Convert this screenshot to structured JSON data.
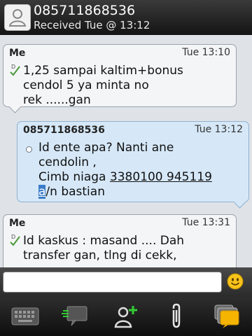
{
  "header": {
    "title": "085711868536",
    "subtitle": "Received Tue @ 13:12",
    "avatar_icon": "contact-avatar-icon"
  },
  "messages": [
    {
      "sender": "Me",
      "time": "Tue 13:10",
      "status_icon": "delivered-check-icon",
      "lines": [
        "1,25 sampai kaltim+bonus",
        "cendol 5 ya minta no",
        "rek ......gan"
      ]
    },
    {
      "sender": "085711868536",
      "time": "Tue 13:12",
      "lines": [
        "Id ente apa? Nanti ane",
        "cendolin ,"
      ],
      "line3_prefix": "Cimb niaga ",
      "line3_number": "3380100 945119",
      "line4_selected": "a",
      "line4_rest": "/n bastian"
    },
    {
      "sender": "Me",
      "time": "Tue 13:31",
      "status_icon": "delivered-check-icon",
      "lines": [
        "Id kaskus : masand .... Dah",
        "transfer gan, tlng di cekk,"
      ]
    }
  ],
  "compose": {
    "input_value": "",
    "emoticon_icon": "smiley-icon"
  },
  "toolbar": [
    {
      "name": "keyboard-icon"
    },
    {
      "name": "chat-icon"
    },
    {
      "name": "invite-contact-icon"
    },
    {
      "name": "attach-icon"
    },
    {
      "name": "open-chats-icon"
    }
  ],
  "colors": {
    "header_bg": "#1f1f1f",
    "incoming_bubble": "#f4f5f7",
    "outgoing_bubble": "#d6e8f8",
    "selection": "#3b7cc8",
    "accent_green": "#33cc33",
    "chats_yellow": "#f5b400"
  }
}
